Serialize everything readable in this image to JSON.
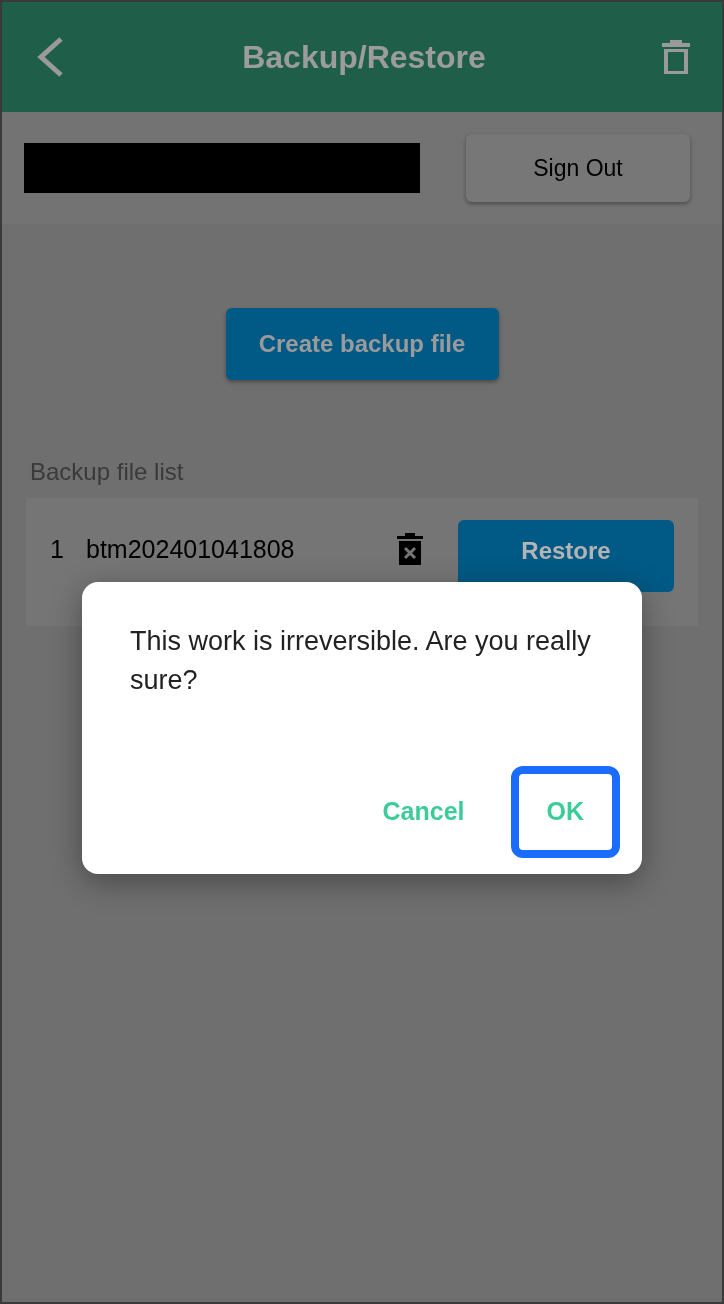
{
  "header": {
    "title": "Backup/Restore"
  },
  "account": {
    "sign_out": "Sign Out"
  },
  "create_button": "Create backup file",
  "backup_list": {
    "title": "Backup file list",
    "rows": [
      {
        "index": "1",
        "name": "btm202401041808",
        "restore": "Restore"
      }
    ]
  },
  "dialog": {
    "message": "This work is irreversible. Are you really sure?",
    "buttons": [
      {
        "label": "Cancel",
        "focused": false
      },
      {
        "label": "OK",
        "focused": true
      }
    ]
  }
}
